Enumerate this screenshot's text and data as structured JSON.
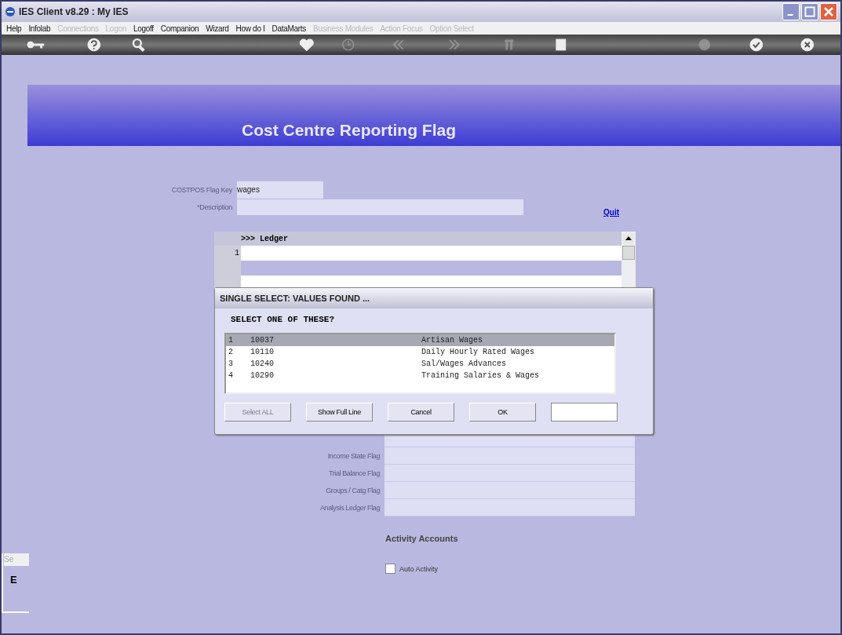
{
  "window": {
    "title": "IES Client v8.29 : My IES"
  },
  "menu": [
    {
      "label": "Help",
      "disabled": false
    },
    {
      "label": "Infolab",
      "disabled": false
    },
    {
      "label": "Connections",
      "disabled": true
    },
    {
      "label": "Logon",
      "disabled": true
    },
    {
      "label": "Logoff",
      "disabled": false
    },
    {
      "label": "Companion",
      "disabled": false
    },
    {
      "label": "Wizard",
      "disabled": false
    },
    {
      "label": "How do I",
      "disabled": false
    },
    {
      "label": "DataMarts",
      "disabled": false
    },
    {
      "label": "Business Modules",
      "disabled": true
    },
    {
      "label": "Action Focus",
      "disabled": true
    },
    {
      "label": "Option Select",
      "disabled": true
    }
  ],
  "toolbar": [
    {
      "kind": "key",
      "disabled": false
    },
    {
      "kind": "help",
      "disabled": false
    },
    {
      "kind": "search",
      "disabled": false
    },
    {
      "kind": "heart",
      "disabled": false
    },
    {
      "kind": "clock",
      "disabled": true
    },
    {
      "kind": "back",
      "disabled": true
    },
    {
      "kind": "forward",
      "disabled": true
    },
    {
      "kind": "sort",
      "disabled": true
    },
    {
      "kind": "stop",
      "disabled": false
    },
    {
      "kind": "recycle",
      "disabled": true
    },
    {
      "kind": "check",
      "disabled": false
    },
    {
      "kind": "close",
      "disabled": false
    }
  ],
  "banner": {
    "title": "Cost Centre Reporting Flag"
  },
  "form": {
    "key_label": "COSTPOS Flag Key",
    "key_value": "wages",
    "description_label": "*Description",
    "quit": "Quit"
  },
  "ledger": {
    "header": ">>> Ledger",
    "rows": [
      "1"
    ]
  },
  "flags": [
    {
      "kind": "covered"
    },
    {
      "kind": "labeled",
      "label": "Income State Flag"
    },
    {
      "kind": "labeled",
      "label": "Trial Balance Flag"
    },
    {
      "kind": "labeled",
      "label": "Groups / Catg Flag"
    },
    {
      "kind": "labeled",
      "label": "Analysis Ledger Flag"
    }
  ],
  "activity": {
    "heading": "Activity Accounts",
    "checkbox": {
      "label": "Auto Activity",
      "checked": false
    }
  },
  "side": {
    "tab": "Se",
    "letter": "E"
  },
  "dialog": {
    "title": "SINGLE SELECT: VALUES FOUND ...",
    "prompt": "SELECT ONE OF THESE?",
    "items": [
      {
        "index": "1",
        "code": "10037",
        "name": "Artisan Wages",
        "selected": true
      },
      {
        "index": "2",
        "code": "10110",
        "name": "Daily Hourly Rated Wages",
        "selected": false
      },
      {
        "index": "3",
        "code": "10240",
        "name": "Sal/Wages Advances",
        "selected": false
      },
      {
        "index": "4",
        "code": "10290",
        "name": "Training Salaries & Wages",
        "selected": false
      }
    ],
    "buttons": [
      {
        "label": "Select ALL",
        "disabled": true
      },
      {
        "label": "Show Full Line",
        "disabled": false
      },
      {
        "label": "Cancel",
        "disabled": false
      },
      {
        "label": "OK",
        "disabled": false
      }
    ]
  }
}
